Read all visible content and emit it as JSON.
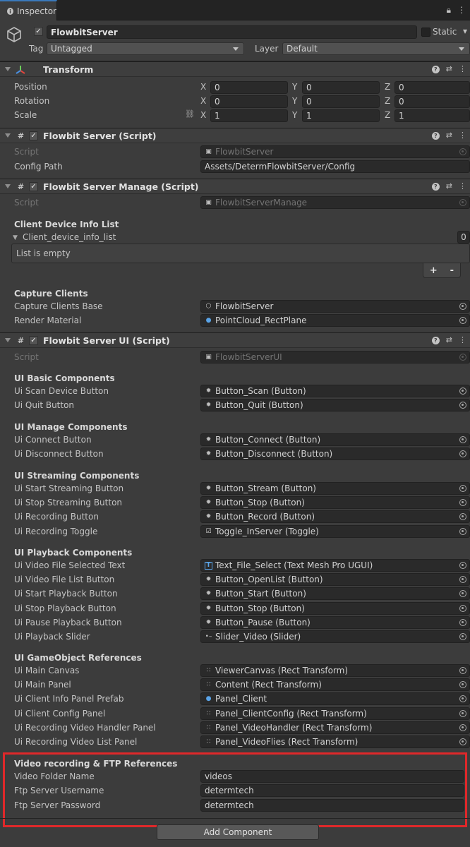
{
  "tab": {
    "title": "Inspector"
  },
  "gameobject": {
    "name": "FlowbitServer",
    "static_label": "Static",
    "tag_label": "Tag",
    "tag_value": "Untagged",
    "layer_label": "Layer",
    "layer_value": "Default"
  },
  "transform": {
    "title": "Transform",
    "rows": [
      {
        "label": "Position",
        "x": "0",
        "y": "0",
        "z": "0"
      },
      {
        "label": "Rotation",
        "x": "0",
        "y": "0",
        "z": "0"
      },
      {
        "label": "Scale",
        "x": "1",
        "y": "1",
        "z": "1"
      }
    ],
    "axes": [
      "X",
      "Y",
      "Z"
    ]
  },
  "server_script": {
    "title": "Flowbit Server (Script)",
    "script_label": "Script",
    "script_value": "FlowbitServer",
    "config_label": "Config Path",
    "config_value": "Assets/DetermFlowbitServer/Config"
  },
  "manage_script": {
    "title": "Flowbit Server Manage (Script)",
    "script_label": "Script",
    "script_value": "FlowbitServerManage",
    "client_header": "Client Device Info List",
    "list_label": "Client_device_info_list",
    "list_count": "0",
    "list_empty": "List is empty",
    "add": "+",
    "remove": "-",
    "capture_header": "Capture Clients",
    "capture_base_label": "Capture Clients Base",
    "capture_base_value": "FlowbitServer",
    "render_label": "Render Material",
    "render_value": "PointCloud_RectPlane"
  },
  "ui_script": {
    "title": "Flowbit Server UI (Script)",
    "script_label": "Script",
    "script_value": "FlowbitServerUI",
    "sections": [
      {
        "header": "UI Basic Components",
        "rows": [
          {
            "label": "Ui Scan Device Button",
            "value": "Button_Scan (Button)",
            "icon": "button-icon"
          },
          {
            "label": "Ui Quit Button",
            "value": "Button_Quit (Button)",
            "icon": "button-icon"
          }
        ]
      },
      {
        "header": "UI Manage Components",
        "rows": [
          {
            "label": "Ui Connect Button",
            "value": "Button_Connect (Button)",
            "icon": "button-icon"
          },
          {
            "label": "Ui Disconnect Button",
            "value": "Button_Disconnect (Button)",
            "icon": "button-icon"
          }
        ]
      },
      {
        "header": "UI Streaming Components",
        "rows": [
          {
            "label": "Ui Start Streaming Button",
            "value": "Button_Stream (Button)",
            "icon": "button-icon"
          },
          {
            "label": "Ui Stop Streaming Button",
            "value": "Button_Stop (Button)",
            "icon": "button-icon"
          },
          {
            "label": "Ui Recording Button",
            "value": "Button_Record (Button)",
            "icon": "button-icon"
          },
          {
            "label": "Ui Recording Toggle",
            "value": "Toggle_InServer (Toggle)",
            "icon": "toggle-icon"
          }
        ]
      },
      {
        "header": "UI Playback Components",
        "rows": [
          {
            "label": "Ui Video File Selected Text",
            "value": "Text_File_Select (Text Mesh Pro UGUI)",
            "icon": "text-icon"
          },
          {
            "label": "Ui Video File List Button",
            "value": "Button_OpenList (Button)",
            "icon": "button-icon"
          },
          {
            "label": "Ui Start Playback Button",
            "value": "Button_Start (Button)",
            "icon": "button-icon"
          },
          {
            "label": "Ui Stop Playback Button",
            "value": "Button_Stop (Button)",
            "icon": "button-icon"
          },
          {
            "label": "Ui Pause Playback Button",
            "value": "Button_Pause (Button)",
            "icon": "button-icon"
          },
          {
            "label": "Ui Playback Slider",
            "value": "Slider_Video (Slider)",
            "icon": "slider-icon"
          }
        ]
      },
      {
        "header": "UI GameObject References",
        "rows": [
          {
            "label": "Ui Main Canvas",
            "value": "ViewerCanvas (Rect Transform)",
            "icon": "rect-transform-icon"
          },
          {
            "label": "Ui Main Panel",
            "value": "Content (Rect Transform)",
            "icon": "rect-transform-icon"
          },
          {
            "label": "Ui Client Info Panel Prefab",
            "value": "Panel_Client",
            "icon": "prefab-icon"
          },
          {
            "label": "Ui Client Config Panel",
            "value": "Panel_ClientConfig (Rect Transform)",
            "icon": "rect-transform-icon"
          },
          {
            "label": "Ui Recording Video Handler Panel",
            "value": "Panel_VideoHandler (Rect Transform)",
            "icon": "rect-transform-icon"
          },
          {
            "label": "Ui Recording Video List Panel",
            "value": "Panel_VideoFlies (Rect Transform)",
            "icon": "rect-transform-icon"
          }
        ]
      }
    ],
    "ftp": {
      "header": "Video recording & FTP References",
      "rows": [
        {
          "label": "Video Folder Name",
          "value": "videos"
        },
        {
          "label": "Ftp Server Username",
          "value": "determtech"
        },
        {
          "label": "Ftp Server Password",
          "value": "determtech"
        }
      ]
    }
  },
  "add_component": "Add Component",
  "colors": {
    "accent": "#3a79bb",
    "highlight": "#e0282a",
    "background": "#3c3c3c"
  }
}
